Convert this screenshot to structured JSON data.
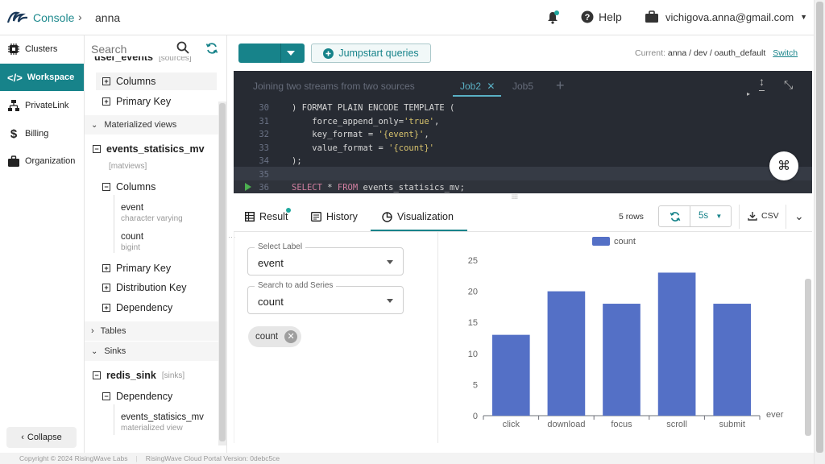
{
  "header": {
    "brand": "Console",
    "breadcrumb": "anna",
    "help": "Help",
    "user": "vichigova.anna@gmail.com"
  },
  "nav": {
    "items": [
      {
        "label": "Clusters",
        "icon": "chip-icon"
      },
      {
        "label": "Workspace",
        "icon": "code-icon"
      },
      {
        "label": "PrivateLink",
        "icon": "network-icon"
      },
      {
        "label": "Billing",
        "icon": "dollar-icon"
      },
      {
        "label": "Organization",
        "icon": "briefcase-icon"
      }
    ],
    "collapse": "Collapse"
  },
  "schema": {
    "search_placeholder": "Search",
    "top_partial": "user_events",
    "top_partial_tag": "[sources]",
    "columns": "Columns",
    "primary_key": "Primary Key",
    "materialized_views": "Materialized views",
    "mv_name": "events_statisics_mv",
    "mv_tag": "[matviews]",
    "mv_columns": "Columns",
    "col1_name": "event",
    "col1_type": "character varying",
    "col2_name": "count",
    "col2_type": "bigint",
    "mv_primary_key": "Primary Key",
    "distribution_key": "Distribution Key",
    "dependency": "Dependency",
    "tables": "Tables",
    "sinks": "Sinks",
    "sink_name": "redis_sink",
    "sink_tag": "[sinks]",
    "sink_dependency": "Dependency",
    "dep_name": "events_statisics_mv",
    "dep_type": "materialized view"
  },
  "toolbar": {
    "jumpstart": "Jumpstart queries",
    "current_label": "Current:",
    "current_value": "anna / dev / oauth_default",
    "switch": "Switch"
  },
  "editor": {
    "tabs": [
      "Joining two streams from two sources",
      "Job2",
      "Job5"
    ],
    "active_tab": "Job2",
    "lines": [
      {
        "n": "30",
        "segs": [
          {
            "t": ") FORMAT PLAIN ENCODE TEMPLATE (",
            "c": ""
          }
        ]
      },
      {
        "n": "31",
        "segs": [
          {
            "t": "    force_append_only=",
            "c": ""
          },
          {
            "t": "'true'",
            "c": "str"
          },
          {
            "t": ",",
            "c": ""
          }
        ]
      },
      {
        "n": "32",
        "segs": [
          {
            "t": "    key_format = ",
            "c": ""
          },
          {
            "t": "'{event}'",
            "c": "str"
          },
          {
            "t": ",",
            "c": ""
          }
        ]
      },
      {
        "n": "33",
        "segs": [
          {
            "t": "    value_format = ",
            "c": ""
          },
          {
            "t": "'{count}'",
            "c": "str"
          }
        ]
      },
      {
        "n": "34",
        "segs": [
          {
            "t": ");",
            "c": ""
          }
        ]
      },
      {
        "n": "35",
        "segs": [
          {
            "t": "",
            "c": ""
          }
        ]
      },
      {
        "n": "36",
        "segs": [
          {
            "t": "SELECT",
            "c": "kw"
          },
          {
            "t": " * ",
            "c": ""
          },
          {
            "t": "FROM",
            "c": "kw"
          },
          {
            "t": " events_statisics_mv;",
            "c": ""
          }
        ]
      }
    ]
  },
  "results": {
    "tab_result": "Result",
    "tab_history": "History",
    "tab_viz": "Visualization",
    "rows": "5 rows",
    "interval": "5s",
    "csv": "CSV"
  },
  "viz": {
    "label_field": "Select Label",
    "label_value": "event",
    "series_field": "Search to add Series",
    "series_value": "count",
    "chip": "count"
  },
  "chart_data": {
    "type": "bar",
    "categories": [
      "click",
      "download",
      "focus",
      "scroll",
      "submit"
    ],
    "series": [
      {
        "name": "count",
        "values": [
          13,
          20,
          18,
          23,
          18
        ]
      }
    ],
    "ylim": [
      0,
      25
    ],
    "yticks": [
      0,
      5,
      10,
      15,
      20,
      25
    ],
    "xlabel": "ever",
    "color": "#5470c6",
    "legend": "top-center"
  },
  "footer": {
    "copyright": "Copyright © 2024 RisingWave Labs",
    "version": "RisingWave Cloud Portal Version: 0debc5ce"
  }
}
